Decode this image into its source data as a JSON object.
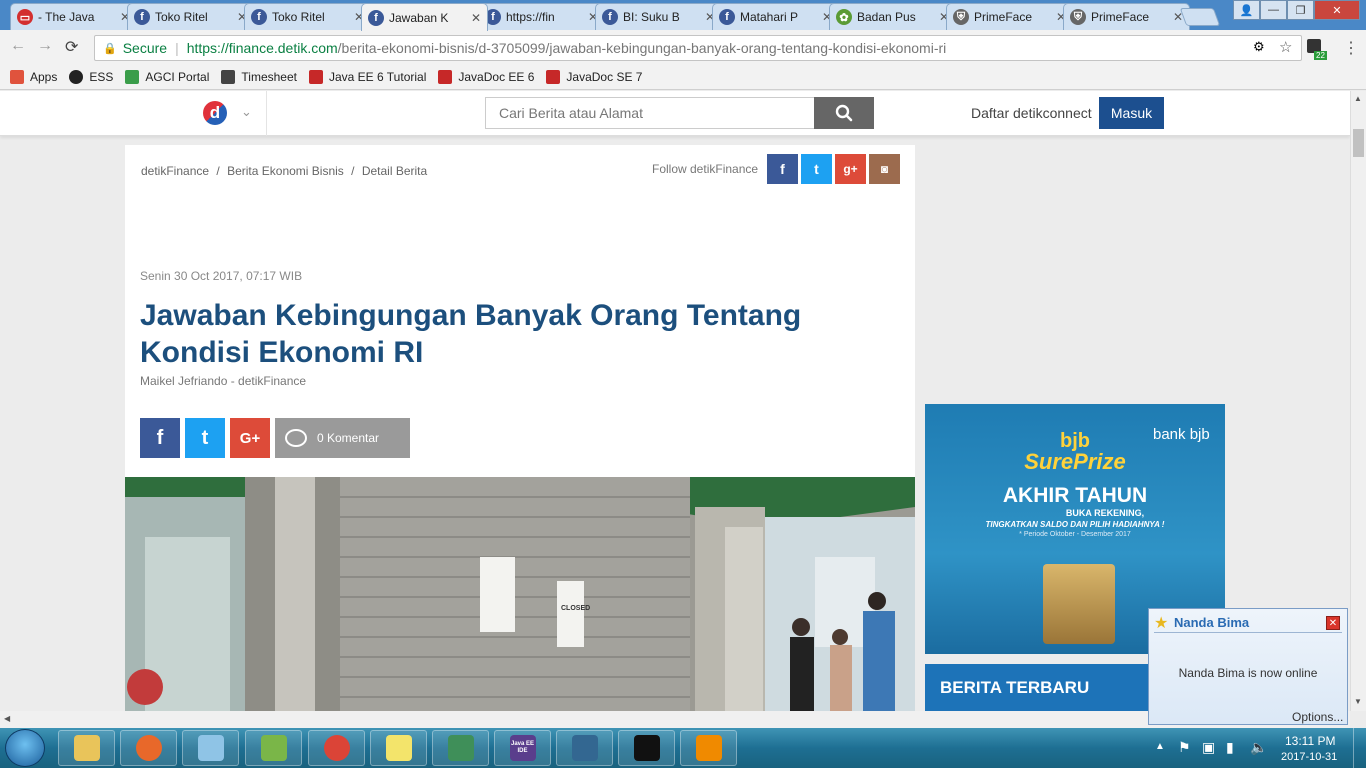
{
  "browser": {
    "tabs": [
      {
        "title": "- The Java",
        "icon": "oracle-icon",
        "color": "#d32f2f"
      },
      {
        "title": "Toko Ritel",
        "icon": "facebook-icon",
        "color": "#3b5998"
      },
      {
        "title": "Toko Ritel",
        "icon": "facebook-icon",
        "color": "#3b5998"
      },
      {
        "title": "Jawaban K",
        "icon": "facebook-icon",
        "color": "#3b5998",
        "active": true
      },
      {
        "title": "https://fin",
        "icon": "facebook-icon",
        "color": "#3b5998"
      },
      {
        "title": "BI: Suku B",
        "icon": "facebook-icon",
        "color": "#3b5998"
      },
      {
        "title": "Matahari P",
        "icon": "facebook-icon",
        "color": "#3b5998"
      },
      {
        "title": "Badan Pus",
        "icon": "leaf-icon",
        "color": "#5b9b35"
      },
      {
        "title": "PrimeFace",
        "icon": "shield-icon",
        "color": "#666666"
      },
      {
        "title": "PrimeFace",
        "icon": "shield-icon",
        "color": "#666666"
      }
    ],
    "secure_label": "Secure",
    "url_host": "https://finance.detik.com",
    "url_path": "/berita-ekonomi-bisnis/d-3705099/jawaban-kebingungan-banyak-orang-tentang-kondisi-ekonomi-ri",
    "extension_badge": "22",
    "bookmarks": [
      {
        "label": "Apps",
        "icon": "apps-grid-icon"
      },
      {
        "label": "ESS",
        "icon": "circle-icon"
      },
      {
        "label": "AGCI Portal",
        "icon": "flower-icon"
      },
      {
        "label": "Timesheet",
        "icon": "calendar-icon"
      },
      {
        "label": "Java EE 6 Tutorial",
        "icon": "oracle-icon"
      },
      {
        "label": "JavaDoc EE 6",
        "icon": "oracle-icon"
      },
      {
        "label": "JavaDoc SE 7",
        "icon": "oracle-icon"
      }
    ]
  },
  "site": {
    "logo_letter": "d",
    "search_placeholder": "Cari Berita atau Alamat",
    "register_label": "Daftar detikconnect",
    "login_label": "Masuk",
    "accent_color": "#1c4f7d"
  },
  "article": {
    "breadcrumb": [
      "detikFinance",
      "Berita Ekonomi Bisnis",
      "Detail Berita"
    ],
    "follow_label": "Follow detikFinance",
    "date": "Senin 30 Oct 2017, 07:17 WIB",
    "title": "Jawaban Kebingungan Banyak Orang Tentang Kondisi Ekonomi RI",
    "author": "Maikel Jefriando - detikFinance",
    "comments_label": "0 Komentar",
    "photo_sign": "CLOSED"
  },
  "ad": {
    "brand": "bank bjb",
    "line1": "bjb",
    "line2": "SurePrize",
    "headline": "AKHIR TAHUN",
    "sub1": "BUKA REKENING,",
    "sub2": "TINGKATKAN SALDO DAN PILIH HADIAHNYA !",
    "period": "* Periode Oktober - Desember 2017"
  },
  "sidebar": {
    "latest_title": "BERITA TERBARU"
  },
  "notification": {
    "name": "Nanda Bima",
    "message": "Nanda Bima is now online",
    "options": "Options..."
  },
  "taskbar": {
    "time": "13:11 PM",
    "date": "2017-10-31",
    "apps": [
      "windows-explorer-icon",
      "firefox-icon",
      "notepad-icon",
      "editor-icon",
      "chrome-icon",
      "sticky-notes-icon",
      "network-icon",
      "java-ee-ide-icon",
      "postgres-icon",
      "terminal-icon",
      "vlc-icon"
    ],
    "java_ee_ide_label": "Java EE IDE"
  }
}
